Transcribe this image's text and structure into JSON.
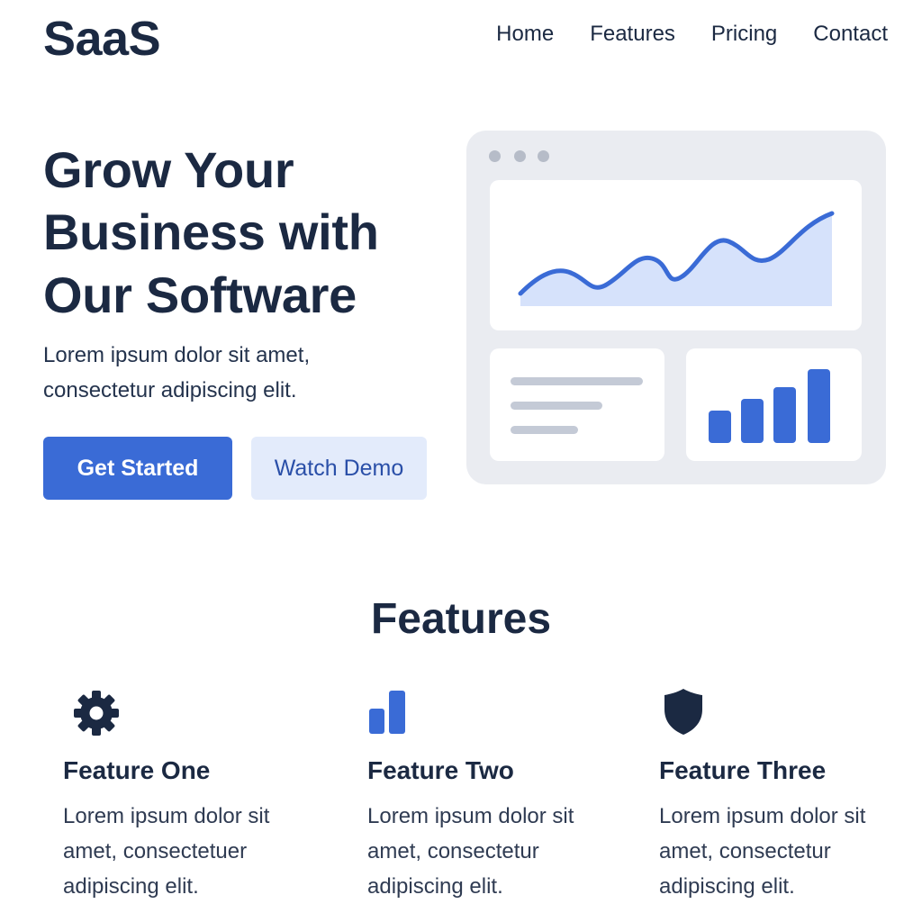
{
  "header": {
    "logo": "SaaS",
    "nav": [
      "Home",
      "Features",
      "Pricing",
      "Contact"
    ]
  },
  "hero": {
    "title": "Grow Your Business with Our Software",
    "subtitle": "Lorem ipsum dolor sit amet, consectetur adipiscing elit.",
    "primary_button": "Get Started",
    "secondary_button": "Watch Demo"
  },
  "mockup": {
    "icons": [
      "window-dots",
      "area-chart",
      "text-lines",
      "bar-chart"
    ],
    "colors": {
      "frame": "#eaecf1",
      "accent": "#3a6bd6",
      "area_fill": "#d6e2fb",
      "lines": "#c4cad6"
    }
  },
  "features": {
    "title": "Features",
    "items": [
      {
        "icon": "gear-icon",
        "title": "Feature One",
        "text": "Lorem ipsum dolor sit amet, consectetuer adipiscing elit."
      },
      {
        "icon": "bar-chart-icon",
        "title": "Feature Two",
        "text": "Lorem ipsum dolor sit amet, consectetur adipiscing elit."
      },
      {
        "icon": "shield-icon",
        "title": "Feature Three",
        "text": "Lorem ipsum dolor sit amet, consectetur adipiscing elit."
      }
    ]
  },
  "colors": {
    "text_dark": "#1b2942",
    "primary": "#3a6bd6",
    "secondary_bg": "#e3ebfb",
    "secondary_text": "#2a4fa8"
  }
}
